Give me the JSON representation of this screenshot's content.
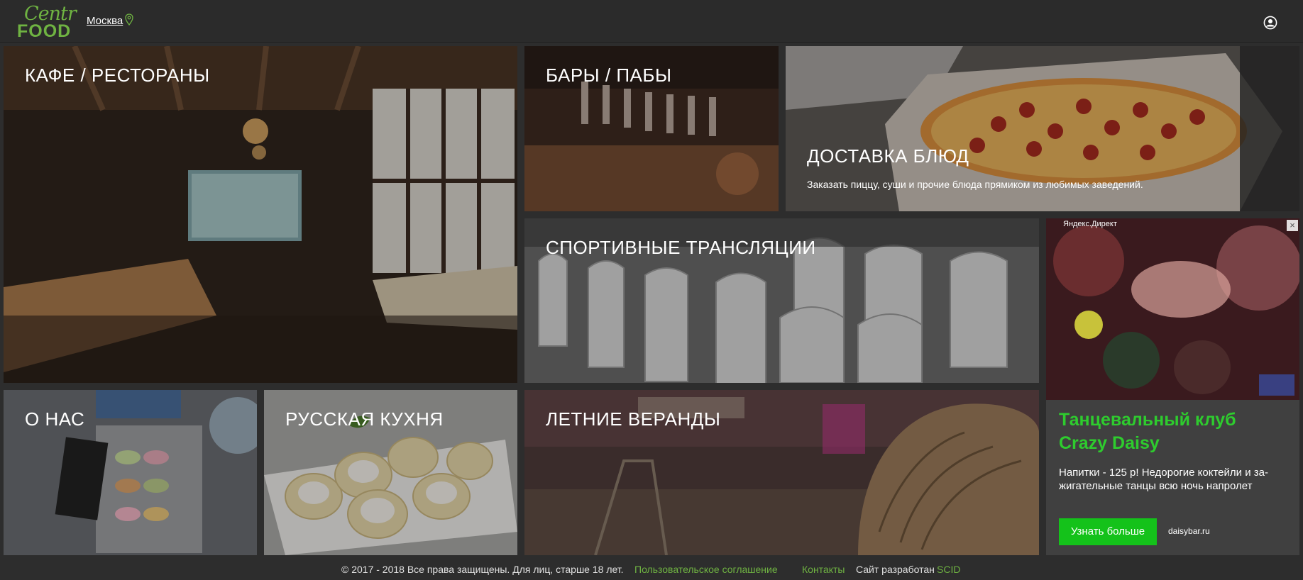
{
  "header": {
    "logo_top": "Centr",
    "logo_bottom": "FOOD",
    "city": "Москва"
  },
  "tiles": {
    "cafe": {
      "title": "КАФЕ / РЕСТОРАНЫ"
    },
    "bars": {
      "title": "БАРЫ / ПАБЫ"
    },
    "delivery": {
      "title": "ДОСТАВКА БЛЮД",
      "description": "Заказать пиццу, суши и прочие блюда прямиком из любимых заведений."
    },
    "sports": {
      "title": "СПОРТИВНЫЕ ТРАНСЛЯЦИИ"
    },
    "about": {
      "title": "О НАС"
    },
    "russian": {
      "title": "РУССКАЯ КУХНЯ"
    },
    "veranda": {
      "title": "ЛЕТНИЕ ВЕРАНДЫ"
    }
  },
  "ad": {
    "source": "Яндекс.Директ",
    "close": "×",
    "title": "Танцевальный клуб Crazy Daisy",
    "text": "Напитки - 125 р! Недорогие коктейли и за-жигательные танцы всю ночь напролет",
    "button": "Узнать больше",
    "domain": "daisybar.ru"
  },
  "footer": {
    "copyright": "© 2017 - 2018 Все права защищены. Для лиц, старше 18 лет.",
    "terms": "Пользовательское соглашение",
    "contacts": "Контакты",
    "developer": "Сайт разработан",
    "developer_link": "SCID"
  },
  "colors": {
    "accent": "#6fb342",
    "ad_title": "#2ecc2e",
    "ad_button": "#14c21a",
    "background": "#2d2d2d"
  }
}
